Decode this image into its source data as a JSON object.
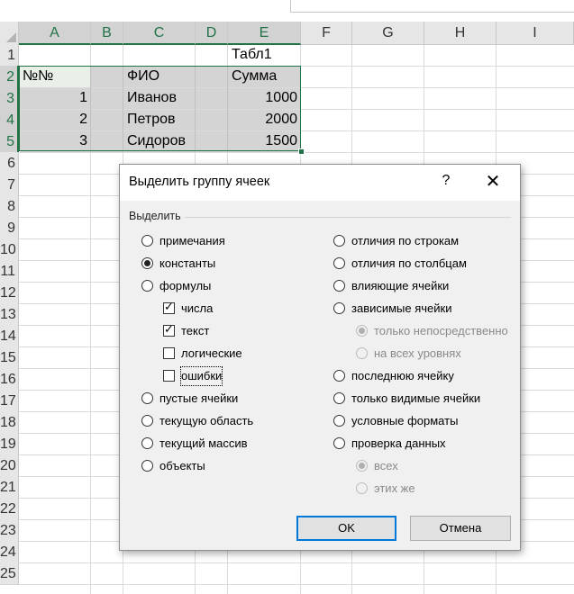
{
  "columns": [
    "A",
    "B",
    "C",
    "D",
    "E",
    "F",
    "G",
    "H",
    "I"
  ],
  "rows": [
    "1",
    "2",
    "3",
    "4",
    "5",
    "6",
    "7",
    "8",
    "9",
    "10",
    "11",
    "12",
    "13",
    "14",
    "15",
    "16",
    "17",
    "18",
    "19",
    "20",
    "21",
    "22",
    "23",
    "24",
    "25"
  ],
  "cells": {
    "e1": "Табл1",
    "a2": "№№",
    "c2": "ФИО",
    "e2": "Сумма",
    "a3": "1",
    "c3": "Иванов",
    "e3": "1000",
    "a4": "2",
    "c4": "Петров",
    "e4": "2000",
    "a5": "3",
    "c5": "Сидоров",
    "e5": "1500"
  },
  "dialog": {
    "title": "Выделить группу ячеек",
    "help": "?",
    "close": "✕",
    "group_label": "Выделить",
    "left_options": {
      "comments": "примечания",
      "constants": "константы",
      "formulas": "формулы",
      "numbers": "числа",
      "text": "текст",
      "logicals": "логические",
      "errors": "ошибки",
      "blanks": "пустые ячейки",
      "current_region": "текущую область",
      "current_array": "текущий массив",
      "objects": "объекты"
    },
    "right_options": {
      "row_differences": "отличия по строкам",
      "column_differences": "отличия по столбцам",
      "precedents": "влияющие ячейки",
      "dependents": "зависимые ячейки",
      "direct_only": "только непосредственно",
      "all_levels": "на всех уровнях",
      "last_cell": "последнюю ячейку",
      "visible_only": "только видимые ячейки",
      "conditional_formats": "условные форматы",
      "data_validation": "проверка данных",
      "all": "всех",
      "same": "этих же"
    },
    "ok": "OK",
    "cancel": "Отмена"
  },
  "colors": {
    "accent": "#217346",
    "dialog_bg": "#f0f0f0",
    "default_button": "#0078d7"
  }
}
